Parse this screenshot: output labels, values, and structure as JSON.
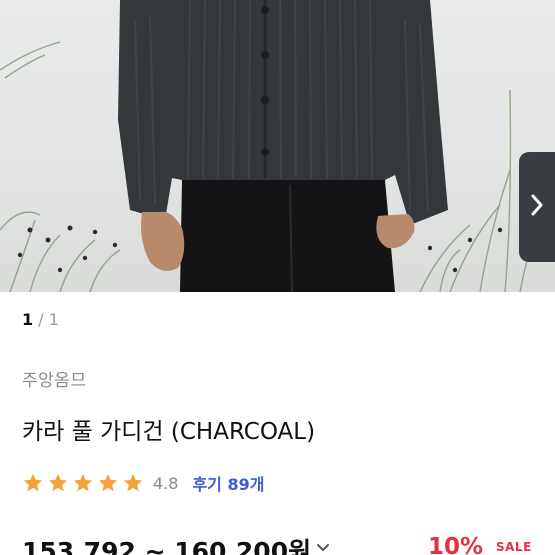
{
  "gallery": {
    "current_index": "1",
    "total_label": "/ 1"
  },
  "product": {
    "brand": "주앙옴므",
    "title": "카라 풀 가디건 (CHARCOAL)",
    "rating": "4.8",
    "rating_stars": 5,
    "review_label": "후기 89개",
    "price_range": "153,792 ~ 160,200원",
    "discount": "10%",
    "sale_badge": "SALE"
  },
  "colors": {
    "star": "#f2a33a",
    "review_link": "#3f5bd6",
    "discount": "#e6323c",
    "next_tab": "#3a3d42"
  },
  "icons": {
    "next_image": "chevron-right-icon",
    "price_expand": "chevron-down-icon",
    "rating_star": "star-icon"
  }
}
